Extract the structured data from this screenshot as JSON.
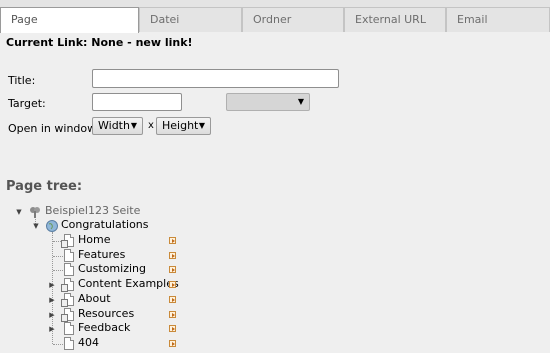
{
  "tabs": [
    {
      "label": "Page",
      "active": true
    },
    {
      "label": "Datei",
      "active": false
    },
    {
      "label": "Ordner",
      "active": false
    },
    {
      "label": "External URL",
      "active": false
    },
    {
      "label": "Email",
      "active": false
    }
  ],
  "current_link": "Current Link: None - new link!",
  "form": {
    "title_label": "Title:",
    "title_value": "",
    "target_label": "Target:",
    "target_value": "",
    "target_select_value": "",
    "open_in_window_label": "Open in window:",
    "width_select": "Width",
    "times": "x",
    "height_select": "Height"
  },
  "page_tree": {
    "heading": "Page tree:",
    "root": "Beispiel123 Seite",
    "level1": "Congratulations",
    "items": [
      "Home",
      "Features",
      "Customizing",
      "Content Examples",
      "About",
      "Resources",
      "Feedback",
      "404"
    ]
  },
  "colors": {
    "background": "#efefef",
    "tab_active": "#ffffff",
    "heading": "#555555"
  }
}
